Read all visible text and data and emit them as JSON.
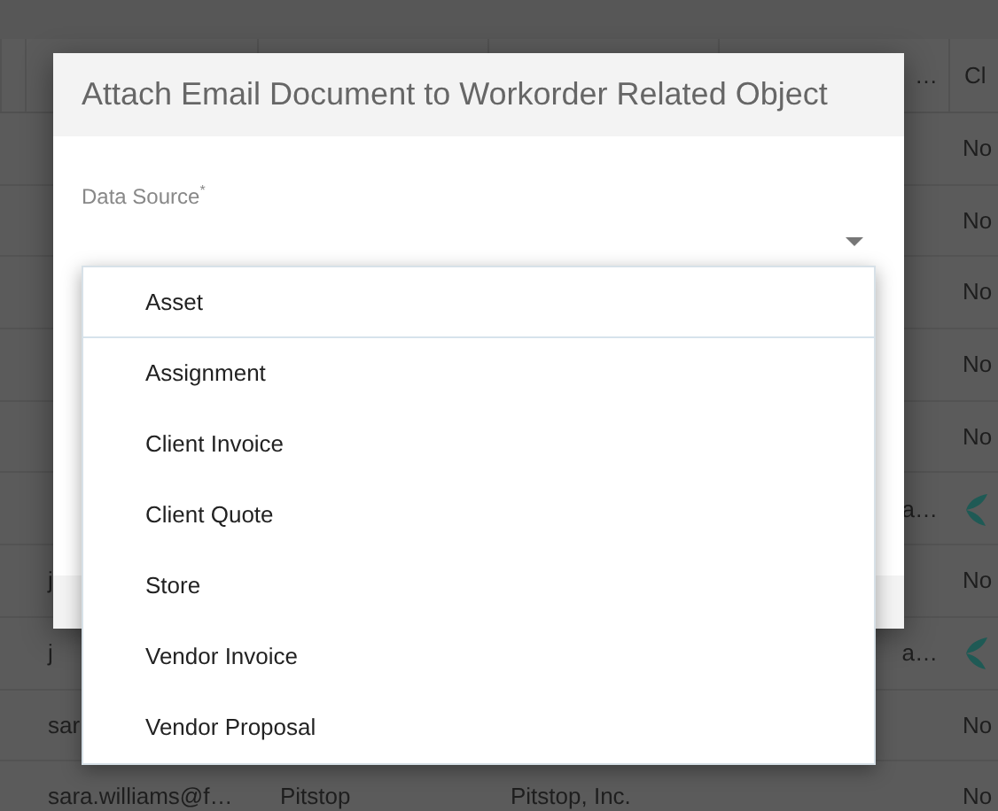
{
  "background_table": {
    "headers": {
      "column_4": "…",
      "column_5": "Cl"
    },
    "rows": [
      {
        "status": {
          "kind": "text",
          "text": "No"
        }
      },
      {
        "status": {
          "kind": "text",
          "text": "No"
        }
      },
      {
        "status": {
          "kind": "text",
          "text": "No"
        }
      },
      {
        "status": {
          "kind": "text",
          "text": "No"
        }
      },
      {
        "status": {
          "kind": "text",
          "text": "No"
        }
      },
      {
        "column_4": "a…",
        "status": {
          "kind": "icon"
        }
      },
      {
        "column_1": "j",
        "status": {
          "kind": "text",
          "text": "No"
        }
      },
      {
        "column_1": "j",
        "column_4": "a…",
        "status": {
          "kind": "icon"
        }
      },
      {
        "column_1": "sar",
        "status": {
          "kind": "text",
          "text": "No"
        }
      },
      {
        "column_1": "sara.williams@f…",
        "column_2": "Pitstop",
        "column_3": "Pitstop, Inc.",
        "status": {
          "kind": "text",
          "text": "No"
        }
      }
    ]
  },
  "dialog": {
    "title": "Attach Email Document to Workorder Related Object",
    "field": {
      "label": "Data Source",
      "required_mark": "*"
    },
    "dropdown": [
      {
        "label": "Asset",
        "selected": true
      },
      {
        "label": "Assignment",
        "selected": false
      },
      {
        "label": "Client Invoice",
        "selected": false
      },
      {
        "label": "Client Quote",
        "selected": false
      },
      {
        "label": "Store",
        "selected": false
      },
      {
        "label": "Vendor Invoice",
        "selected": false
      },
      {
        "label": "Vendor Proposal",
        "selected": false
      }
    ]
  }
}
